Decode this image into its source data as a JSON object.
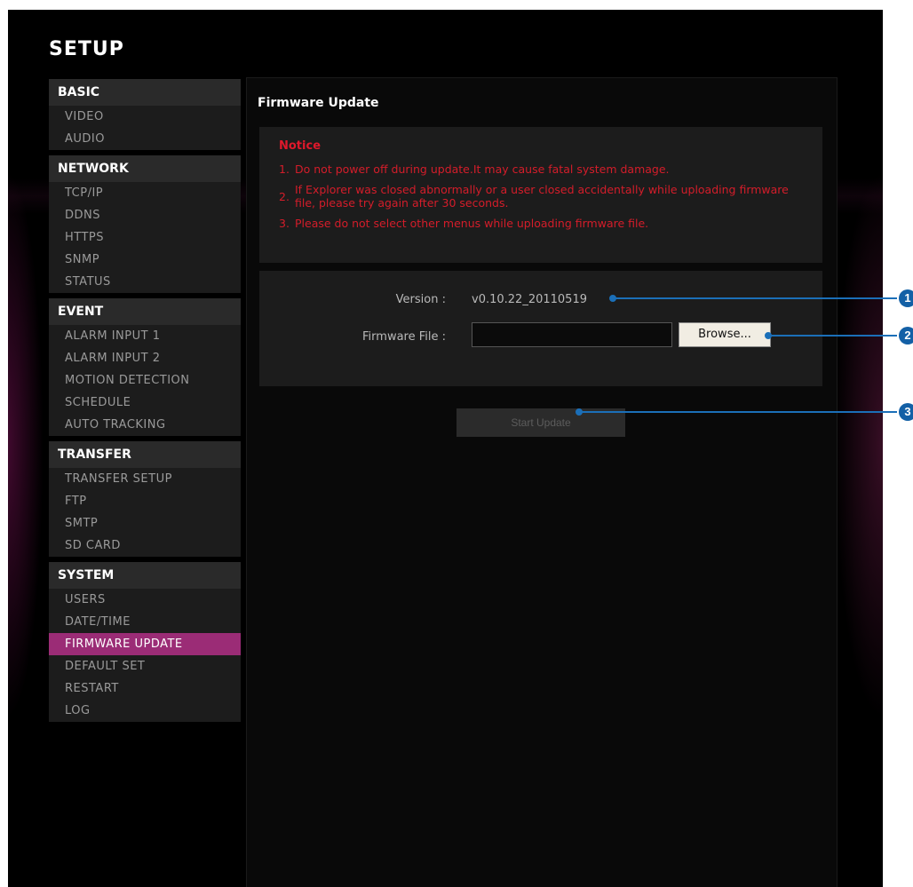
{
  "title": "SETUP",
  "sidebar": {
    "groups": [
      {
        "title": "BASIC",
        "items": [
          "VIDEO",
          "AUDIO"
        ]
      },
      {
        "title": "NETWORK",
        "items": [
          "TCP/IP",
          "DDNS",
          "HTTPS",
          "SNMP",
          "STATUS"
        ]
      },
      {
        "title": "EVENT",
        "items": [
          "ALARM INPUT 1",
          "ALARM INPUT 2",
          "MOTION DETECTION",
          "SCHEDULE",
          "AUTO TRACKING"
        ]
      },
      {
        "title": "TRANSFER",
        "items": [
          "TRANSFER SETUP",
          "FTP",
          "SMTP",
          "SD CARD"
        ]
      },
      {
        "title": "SYSTEM",
        "items": [
          "USERS",
          "DATE/TIME",
          "FIRMWARE UPDATE",
          "DEFAULT SET",
          "RESTART",
          "LOG"
        ]
      }
    ],
    "active_item": "FIRMWARE UPDATE"
  },
  "main": {
    "page_title": "Firmware Update",
    "notice": {
      "title": "Notice",
      "items": [
        {
          "num": "1.",
          "text": "Do not power off during update.It may cause fatal system damage."
        },
        {
          "num": "2.",
          "text": "If Explorer was closed abnormally or a user closed accidentally while uploading firmware file, please try again after 30 seconds."
        },
        {
          "num": "3.",
          "text": "Please do not select other menus while uploading firmware file."
        }
      ]
    },
    "version_label": "Version :",
    "version_value": "v0.10.22_20110519",
    "file_label": "Firmware File :",
    "file_value": "",
    "browse_label": "Browse...",
    "start_label": "Start Update"
  },
  "callouts": [
    "1",
    "2",
    "3"
  ],
  "colors": {
    "accent": "#9b2c76",
    "notice": "#d41d2a",
    "callout": "#1360a6"
  }
}
